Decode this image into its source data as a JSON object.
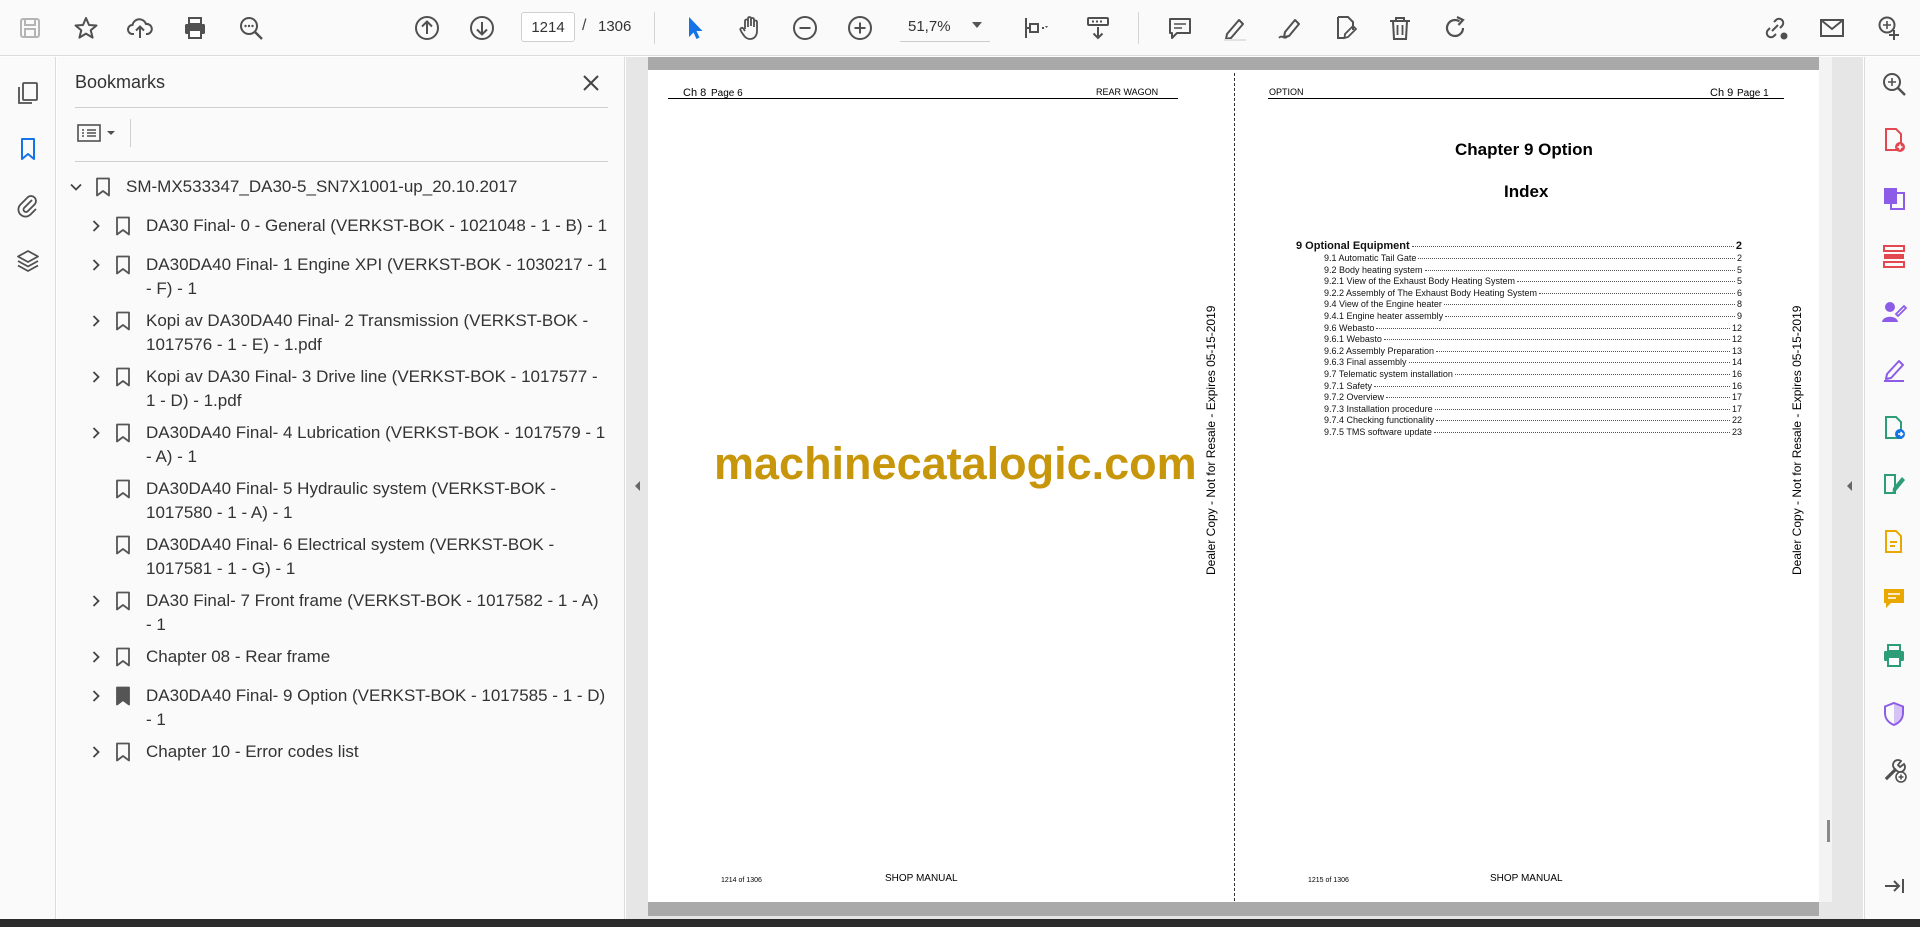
{
  "toolbar": {
    "current_page": "1214",
    "page_separator": "/",
    "total_pages": "1306",
    "zoom": "51,7%"
  },
  "bookmarks": {
    "title": "Bookmarks",
    "root": "SM-MX533347_DA30-5_SN7X1001-up_20.10.2017",
    "items": [
      {
        "label": "DA30 Final- 0 - General (VERKST-BOK - 1021048 - 1 - B) - 1",
        "expandable": true
      },
      {
        "label": "DA30DA40 Final- 1 Engine XPI (VERKST-BOK - 1030217 - 1 - F) - 1",
        "expandable": true
      },
      {
        "label": "Kopi av DA30DA40 Final- 2 Transmission (VERKST-BOK - 1017576 - 1 - E) - 1.pdf",
        "expandable": true
      },
      {
        "label": "Kopi av DA30 Final- 3 Drive line (VERKST-BOK - 1017577 - 1 - D) - 1.pdf",
        "expandable": true
      },
      {
        "label": "DA30DA40 Final- 4 Lubrication (VERKST-BOK - 1017579 - 1 - A) - 1",
        "expandable": true
      },
      {
        "label": "DA30DA40 Final- 5 Hydraulic system (VERKST-BOK - 1017580 - 1 - A) - 1",
        "expandable": false
      },
      {
        "label": "DA30DA40 Final- 6 Electrical system (VERKST-BOK - 1017581 - 1 - G) - 1",
        "expandable": false
      },
      {
        "label": "DA30 Final- 7 Front frame (VERKST-BOK - 1017582 - 1 - A) - 1",
        "expandable": true
      },
      {
        "label": "Chapter 08 - Rear frame",
        "expandable": true
      },
      {
        "label": "DA30DA40 Final- 9 Option (VERKST-BOK - 1017585 - 1 - D) - 1",
        "expandable": true
      },
      {
        "label": "Chapter 10 - Error codes list",
        "expandable": true
      }
    ]
  },
  "left_page": {
    "chapter": "Ch 8",
    "page_label": "Page 6",
    "section": "REAR WAGON",
    "footer_count": "1214 of 1306",
    "footer_title": "SHOP MANUAL",
    "side_note": "Dealer Copy - Not for Resale - Expires 05-15-2019"
  },
  "right_page": {
    "section": "OPTION",
    "chapter": "Ch 9",
    "page_label": "Page 1",
    "title": "Chapter 9 Option",
    "subtitle": "Index",
    "footer_count": "1215 of 1306",
    "footer_title": "SHOP MANUAL",
    "side_note": "Dealer Copy - Not for Resale - Expires 05-15-2019",
    "toc": [
      {
        "text": "9 Optional Equipment",
        "page": "2",
        "level": 0
      },
      {
        "text": "9.1 Automatic Tail Gate",
        "page": "2",
        "level": 1
      },
      {
        "text": "9.2 Body heating system",
        "page": "5",
        "level": 1
      },
      {
        "text": "9.2.1 View of the Exhaust Body Heating System",
        "page": "5",
        "level": 1
      },
      {
        "text": "9.2.2 Assembly of The Exhaust Body Heating System",
        "page": "6",
        "level": 1
      },
      {
        "text": "9.4 View of the Engine heater",
        "page": "8",
        "level": 1
      },
      {
        "text": "9.4.1 Engine heater assembly",
        "page": "9",
        "level": 1
      },
      {
        "text": "9.6 Webasto",
        "page": "12",
        "level": 1
      },
      {
        "text": "9.6.1 Webasto",
        "page": "12",
        "level": 1
      },
      {
        "text": "9.6.2 Assembly Preparation",
        "page": "13",
        "level": 1
      },
      {
        "text": "9.6.3 Final assembly",
        "page": "14",
        "level": 1
      },
      {
        "text": "9.7 Telematic system installation",
        "page": "16",
        "level": 1
      },
      {
        "text": "9.7.1 Safety",
        "page": "16",
        "level": 1
      },
      {
        "text": "9.7.2 Overview",
        "page": "17",
        "level": 1
      },
      {
        "text": "9.7.3 Installation procedure",
        "page": "17",
        "level": 1
      },
      {
        "text": "9.7.4 Checking functionality",
        "page": "22",
        "level": 1
      },
      {
        "text": "9.7.5 TMS software update",
        "page": "23",
        "level": 1
      }
    ]
  },
  "watermark": "machinecatalogic.com",
  "colors": {
    "accent_blue": "#1473e6",
    "watermark": "#c8960a",
    "icon_gray": "#505050",
    "tool_red": "#e34850",
    "tool_purple": "#8c5ce8",
    "tool_green": "#2d9d78",
    "tool_yellow": "#e8a800"
  }
}
